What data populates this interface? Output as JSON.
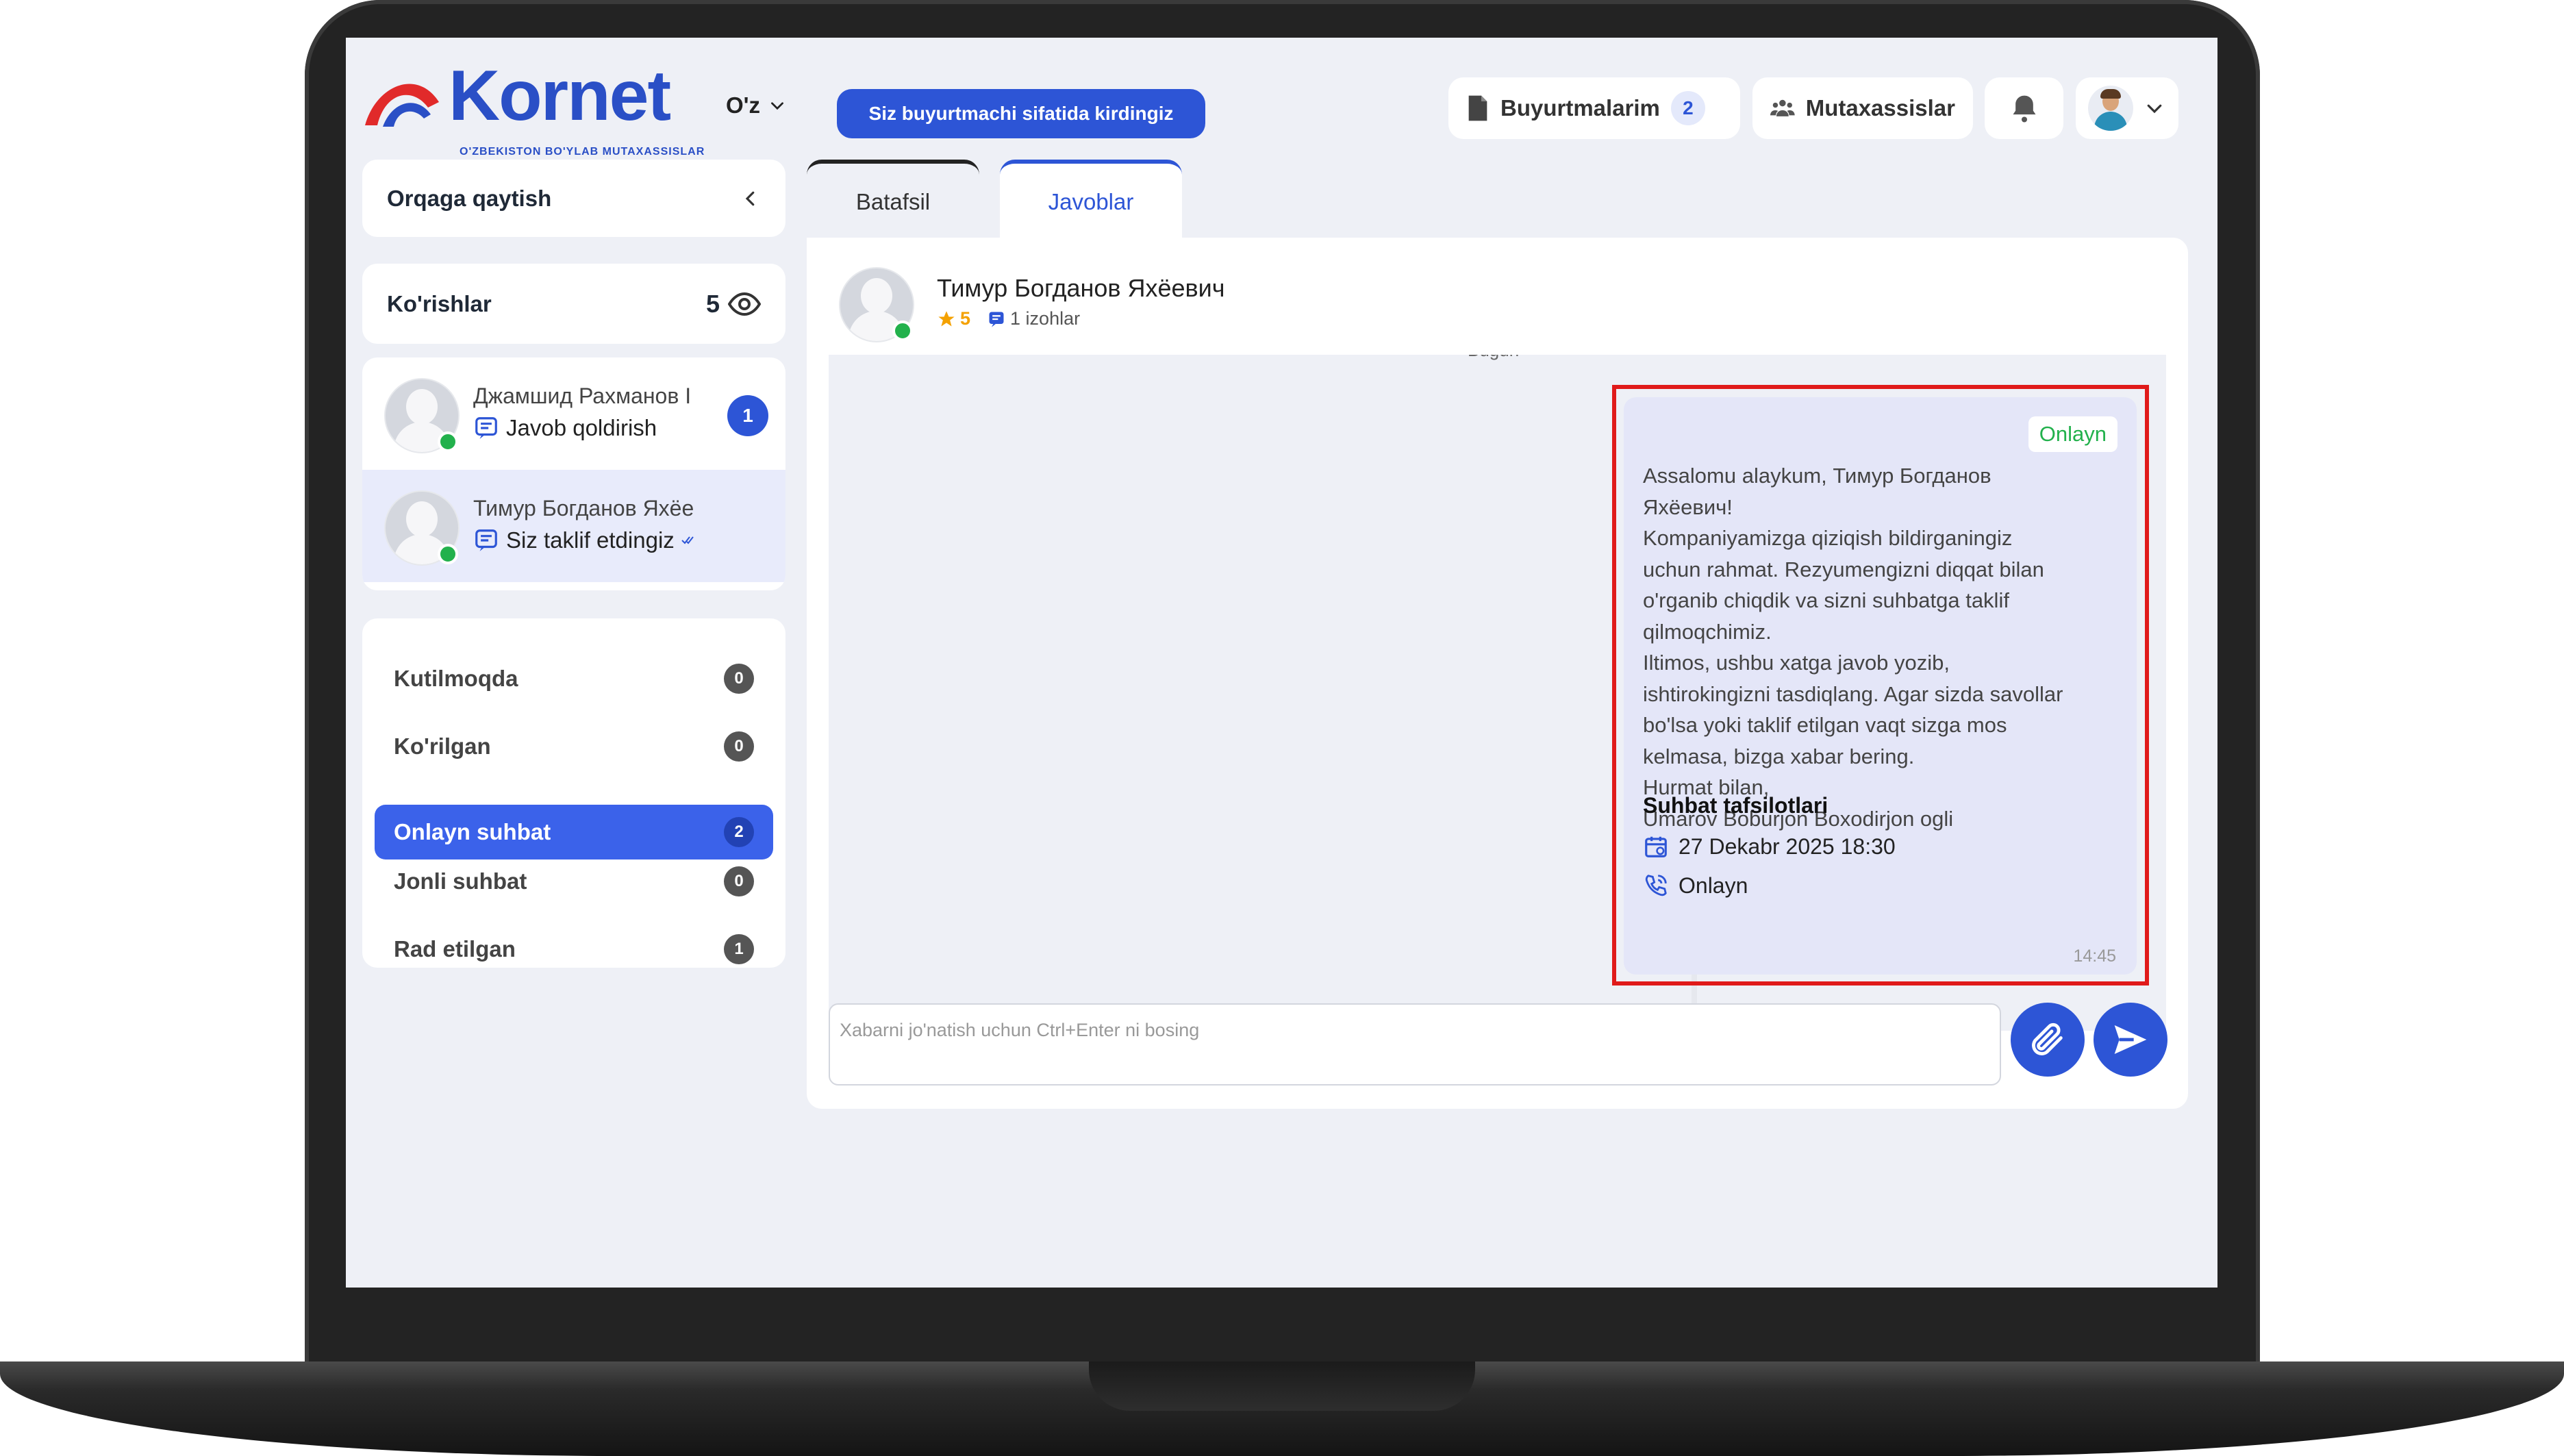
{
  "header": {
    "logo_text": "Kornet",
    "logo_subtitle": "O'ZBEKISTON BO'YLAB MUTAXASSISLAR",
    "language": "O'z",
    "mode_button": "Siz buyurtmachi sifatida kirdingiz",
    "orders_label": "Buyurtmalarim",
    "orders_count": "2",
    "specialists_label": "Mutaxassislar"
  },
  "sidebar": {
    "back_label": "Orqaga qaytish",
    "views_label": "Ko'rishlar",
    "views_count": "5",
    "contacts": [
      {
        "name": "Джамшид Рахманов Ι",
        "subtitle": "Javob qoldirish",
        "unread": "1"
      },
      {
        "name": "Тимур Богданов Яхёе",
        "subtitle": "Siz taklif etdingiz"
      }
    ],
    "statuses": [
      {
        "label": "Kutilmoqda",
        "count": "0"
      },
      {
        "label": "Ko'rilgan",
        "count": "0"
      },
      {
        "label": "Onlayn suhbat",
        "count": "2"
      },
      {
        "label": "Jonli suhbat",
        "count": "0"
      },
      {
        "label": "Rad etilgan",
        "count": "1"
      }
    ]
  },
  "tabs": {
    "details": "Batafsil",
    "replies": "Javoblar"
  },
  "chat": {
    "person_name": "Тимур Богданов Яхёевич",
    "rating": "5",
    "comments": "1 izohlar",
    "day_label": "Bugun",
    "message": {
      "badge": "Onlayn",
      "text": "Assalomu alaykum, Тимур Богданов\nЯхёевич!\nKompaniyamizga qiziqish bildirganingiz\nuchun rahmat. Rezyumengizni diqqat bilan\no'rganib chiqdik va sizni suhbatga taklif\nqilmoqchimiz.\nIltimos, ushbu xatga javob yozib,\nishtirokingizni tasdiqlang. Agar sizda savollar\nbo'lsa yoki taklif etilgan vaqt sizga mos\nkelmasa, bizga xabar bering.\nHurmat bilan,\nUmarov Boburjon Boxodirjon ogli",
      "details_title": "Suhbat tafsilotlari",
      "date": "27 Dekabr 2025 18:30",
      "format": "Onlayn",
      "time": "14:45"
    },
    "input_placeholder": "Xabarni jo'natish uchun Ctrl+Enter ni bosing"
  },
  "colors": {
    "accent": "#2d55d6",
    "online": "#22b14c",
    "highlight": "#e01a1a",
    "star": "#f4a100"
  }
}
